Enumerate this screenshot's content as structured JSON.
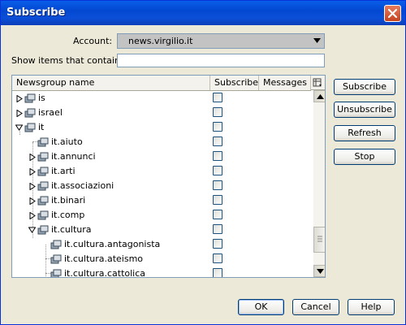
{
  "window": {
    "title": "Subscribe"
  },
  "account": {
    "label": "Account:",
    "value": "news.virgilio.it"
  },
  "filter": {
    "label": "Show items that contain:",
    "value": ""
  },
  "tree": {
    "columns": [
      "Newsgroup name",
      "Subscribe",
      "Messages"
    ],
    "rows": [
      {
        "label": "is",
        "expander": "collapsed",
        "subscribed": false
      },
      {
        "label": "israel",
        "expander": "collapsed",
        "subscribed": false
      },
      {
        "label": "it",
        "expander": "expanded",
        "subscribed": false
      },
      {
        "label": "it.aiuto",
        "expander": "none",
        "subscribed": false
      },
      {
        "label": "it.annunci",
        "expander": "collapsed",
        "subscribed": false
      },
      {
        "label": "it.arti",
        "expander": "collapsed",
        "subscribed": false
      },
      {
        "label": "it.associazioni",
        "expander": "collapsed",
        "subscribed": false
      },
      {
        "label": "it.binari",
        "expander": "collapsed",
        "subscribed": false
      },
      {
        "label": "it.comp",
        "expander": "collapsed",
        "subscribed": false
      },
      {
        "label": "it.cultura",
        "expander": "expanded",
        "subscribed": false
      },
      {
        "label": "it.cultura.antagonista",
        "expander": "none",
        "subscribed": false
      },
      {
        "label": "it.cultura.ateismo",
        "expander": "none",
        "subscribed": false
      },
      {
        "label": "it.cultura.cattolica",
        "expander": "none",
        "subscribed": false
      }
    ]
  },
  "side_buttons": {
    "subscribe": "Subscribe",
    "unsubscribe": "Unsubscribe",
    "refresh": "Refresh",
    "stop": "Stop"
  },
  "bottom_buttons": {
    "ok": "OK",
    "cancel": "Cancel",
    "help": "Help"
  },
  "colors": {
    "titlebar": "#0348d0",
    "dialog_bg": "#ece9d8",
    "close_button": "#d2512f",
    "field_border": "#7f9db9"
  }
}
